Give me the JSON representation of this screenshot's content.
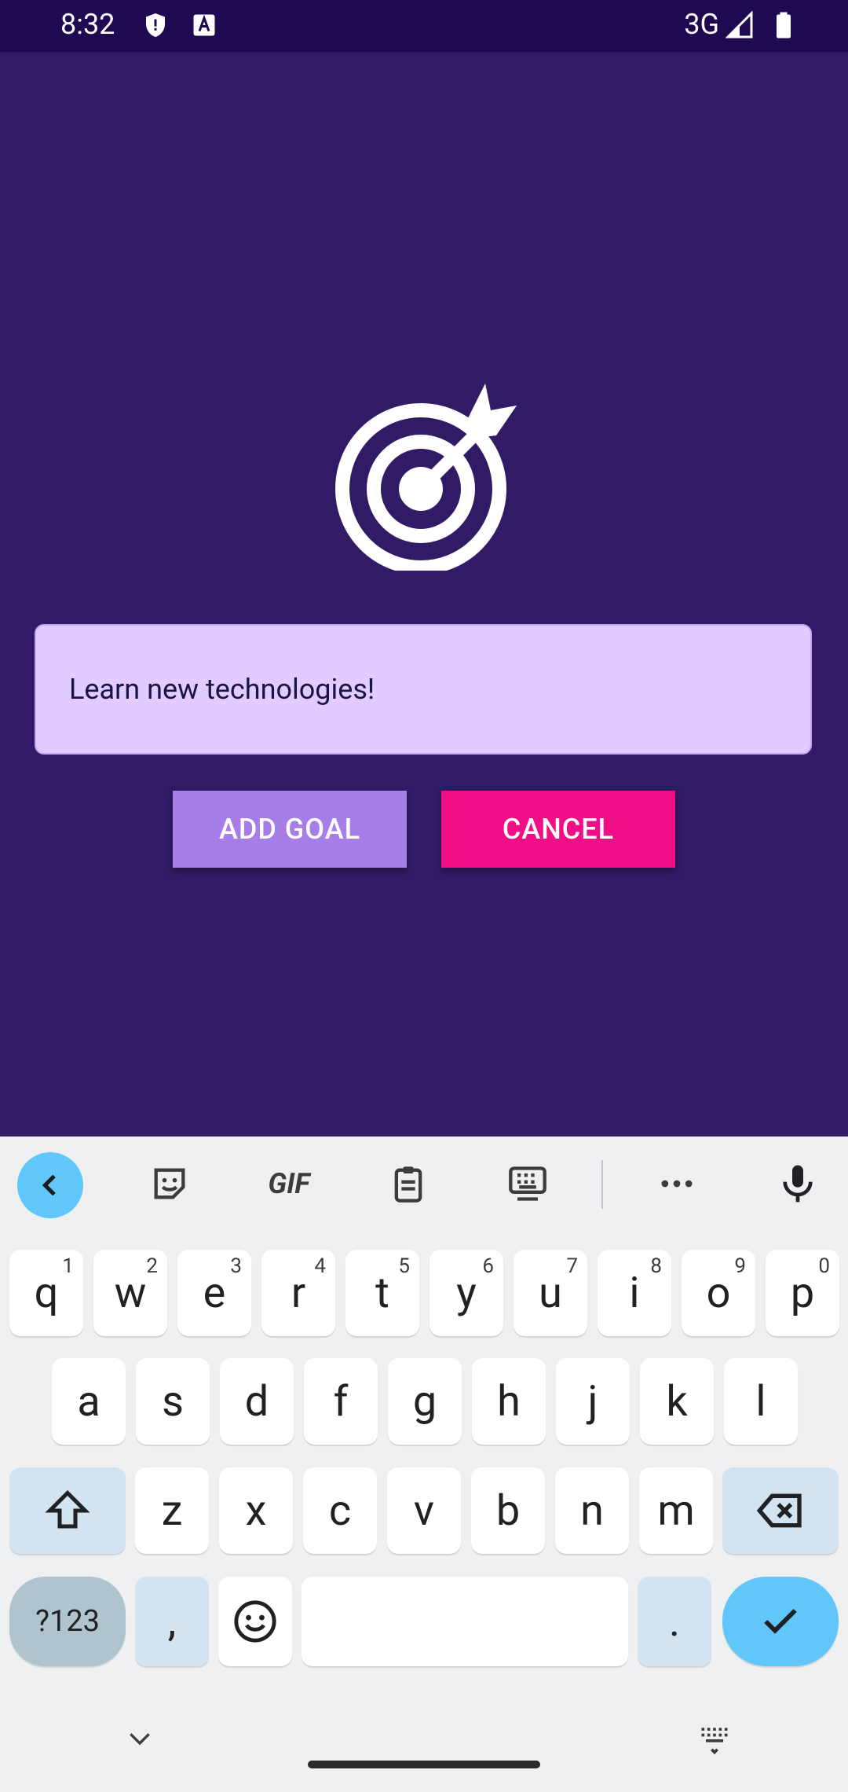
{
  "status_bar": {
    "time": "8:32",
    "network": "3G",
    "icons": [
      "shield-icon",
      "text-a-icon",
      "signal-icon",
      "battery-icon"
    ]
  },
  "app": {
    "logo_icon": "target-arrow-icon",
    "goal_input": {
      "value": "Learn new technologies!",
      "placeholder": ""
    },
    "buttons": {
      "add_goal": "ADD GOAL",
      "cancel": "CANCEL"
    },
    "colors": {
      "background": "#311b66",
      "input_bg": "#e2ccff",
      "add_btn": "#a77de8",
      "cancel_btn": "#f00f87"
    }
  },
  "keyboard": {
    "toolbar": {
      "gif": "GIF",
      "icons": [
        "chevron-left-icon",
        "sticker-icon",
        "gif-icon",
        "clipboard-icon",
        "keyboard-settings-icon",
        "more-icon",
        "microphone-icon"
      ]
    },
    "row1": [
      {
        "k": "q",
        "h": "1"
      },
      {
        "k": "w",
        "h": "2"
      },
      {
        "k": "e",
        "h": "3"
      },
      {
        "k": "r",
        "h": "4"
      },
      {
        "k": "t",
        "h": "5"
      },
      {
        "k": "y",
        "h": "6"
      },
      {
        "k": "u",
        "h": "7"
      },
      {
        "k": "i",
        "h": "8"
      },
      {
        "k": "o",
        "h": "9"
      },
      {
        "k": "p",
        "h": "0"
      }
    ],
    "row2": [
      "a",
      "s",
      "d",
      "f",
      "g",
      "h",
      "j",
      "k",
      "l"
    ],
    "row3": [
      "z",
      "x",
      "c",
      "v",
      "b",
      "n",
      "m"
    ],
    "row4": {
      "sym": "?123",
      "comma": ",",
      "period": "."
    }
  }
}
